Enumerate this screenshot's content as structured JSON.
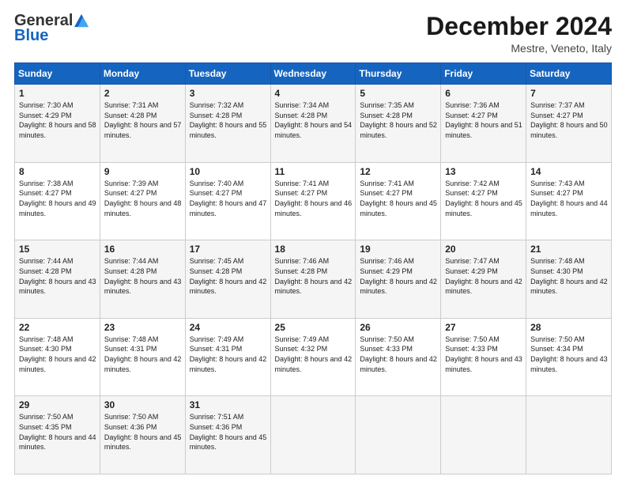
{
  "header": {
    "logo_general": "General",
    "logo_blue": "Blue",
    "month_title": "December 2024",
    "location": "Mestre, Veneto, Italy"
  },
  "weekdays": [
    "Sunday",
    "Monday",
    "Tuesday",
    "Wednesday",
    "Thursday",
    "Friday",
    "Saturday"
  ],
  "weeks": [
    [
      {
        "day": "1",
        "sunrise": "7:30 AM",
        "sunset": "4:29 PM",
        "daylight": "8 hours and 58 minutes."
      },
      {
        "day": "2",
        "sunrise": "7:31 AM",
        "sunset": "4:28 PM",
        "daylight": "8 hours and 57 minutes."
      },
      {
        "day": "3",
        "sunrise": "7:32 AM",
        "sunset": "4:28 PM",
        "daylight": "8 hours and 55 minutes."
      },
      {
        "day": "4",
        "sunrise": "7:34 AM",
        "sunset": "4:28 PM",
        "daylight": "8 hours and 54 minutes."
      },
      {
        "day": "5",
        "sunrise": "7:35 AM",
        "sunset": "4:28 PM",
        "daylight": "8 hours and 52 minutes."
      },
      {
        "day": "6",
        "sunrise": "7:36 AM",
        "sunset": "4:27 PM",
        "daylight": "8 hours and 51 minutes."
      },
      {
        "day": "7",
        "sunrise": "7:37 AM",
        "sunset": "4:27 PM",
        "daylight": "8 hours and 50 minutes."
      }
    ],
    [
      {
        "day": "8",
        "sunrise": "7:38 AM",
        "sunset": "4:27 PM",
        "daylight": "8 hours and 49 minutes."
      },
      {
        "day": "9",
        "sunrise": "7:39 AM",
        "sunset": "4:27 PM",
        "daylight": "8 hours and 48 minutes."
      },
      {
        "day": "10",
        "sunrise": "7:40 AM",
        "sunset": "4:27 PM",
        "daylight": "8 hours and 47 minutes."
      },
      {
        "day": "11",
        "sunrise": "7:41 AM",
        "sunset": "4:27 PM",
        "daylight": "8 hours and 46 minutes."
      },
      {
        "day": "12",
        "sunrise": "7:41 AM",
        "sunset": "4:27 PM",
        "daylight": "8 hours and 45 minutes."
      },
      {
        "day": "13",
        "sunrise": "7:42 AM",
        "sunset": "4:27 PM",
        "daylight": "8 hours and 45 minutes."
      },
      {
        "day": "14",
        "sunrise": "7:43 AM",
        "sunset": "4:27 PM",
        "daylight": "8 hours and 44 minutes."
      }
    ],
    [
      {
        "day": "15",
        "sunrise": "7:44 AM",
        "sunset": "4:28 PM",
        "daylight": "8 hours and 43 minutes."
      },
      {
        "day": "16",
        "sunrise": "7:44 AM",
        "sunset": "4:28 PM",
        "daylight": "8 hours and 43 minutes."
      },
      {
        "day": "17",
        "sunrise": "7:45 AM",
        "sunset": "4:28 PM",
        "daylight": "8 hours and 42 minutes."
      },
      {
        "day": "18",
        "sunrise": "7:46 AM",
        "sunset": "4:28 PM",
        "daylight": "8 hours and 42 minutes."
      },
      {
        "day": "19",
        "sunrise": "7:46 AM",
        "sunset": "4:29 PM",
        "daylight": "8 hours and 42 minutes."
      },
      {
        "day": "20",
        "sunrise": "7:47 AM",
        "sunset": "4:29 PM",
        "daylight": "8 hours and 42 minutes."
      },
      {
        "day": "21",
        "sunrise": "7:48 AM",
        "sunset": "4:30 PM",
        "daylight": "8 hours and 42 minutes."
      }
    ],
    [
      {
        "day": "22",
        "sunrise": "7:48 AM",
        "sunset": "4:30 PM",
        "daylight": "8 hours and 42 minutes."
      },
      {
        "day": "23",
        "sunrise": "7:48 AM",
        "sunset": "4:31 PM",
        "daylight": "8 hours and 42 minutes."
      },
      {
        "day": "24",
        "sunrise": "7:49 AM",
        "sunset": "4:31 PM",
        "daylight": "8 hours and 42 minutes."
      },
      {
        "day": "25",
        "sunrise": "7:49 AM",
        "sunset": "4:32 PM",
        "daylight": "8 hours and 42 minutes."
      },
      {
        "day": "26",
        "sunrise": "7:50 AM",
        "sunset": "4:33 PM",
        "daylight": "8 hours and 42 minutes."
      },
      {
        "day": "27",
        "sunrise": "7:50 AM",
        "sunset": "4:33 PM",
        "daylight": "8 hours and 43 minutes."
      },
      {
        "day": "28",
        "sunrise": "7:50 AM",
        "sunset": "4:34 PM",
        "daylight": "8 hours and 43 minutes."
      }
    ],
    [
      {
        "day": "29",
        "sunrise": "7:50 AM",
        "sunset": "4:35 PM",
        "daylight": "8 hours and 44 minutes."
      },
      {
        "day": "30",
        "sunrise": "7:50 AM",
        "sunset": "4:36 PM",
        "daylight": "8 hours and 45 minutes."
      },
      {
        "day": "31",
        "sunrise": "7:51 AM",
        "sunset": "4:36 PM",
        "daylight": "8 hours and 45 minutes."
      },
      null,
      null,
      null,
      null
    ]
  ]
}
